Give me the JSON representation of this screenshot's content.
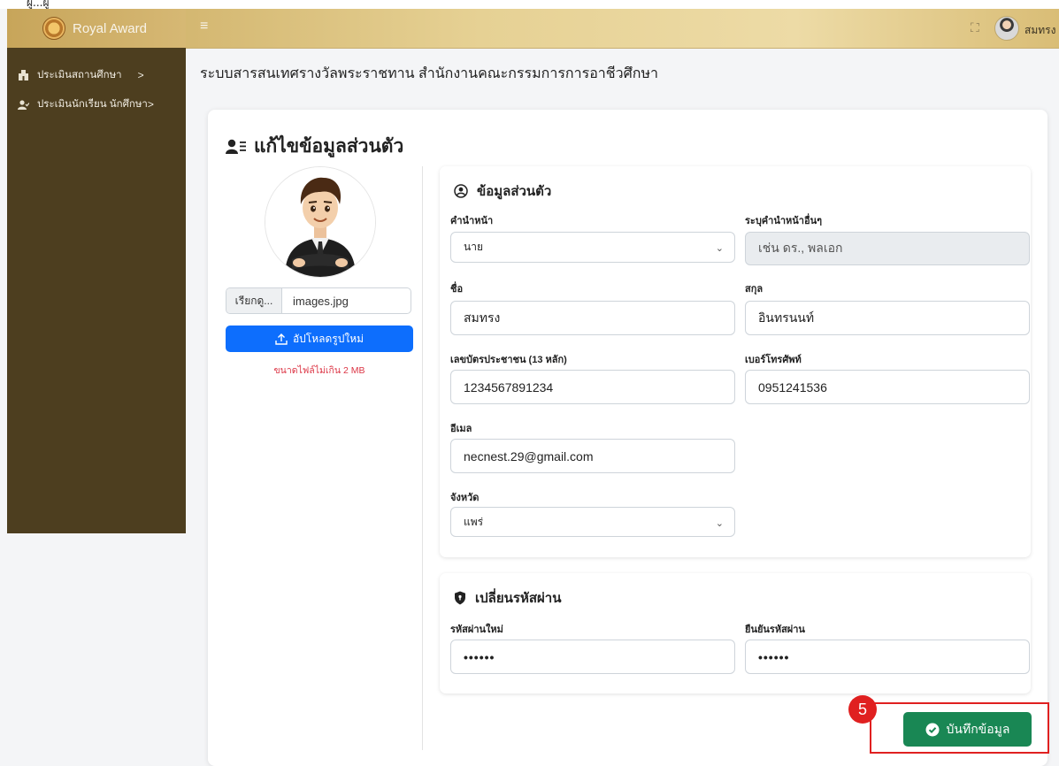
{
  "top_strip_text": "ผู้...ผู้",
  "header": {
    "brand": "Royal Award",
    "hamburger_icon": "menu-icon",
    "username": "สมทรง"
  },
  "sidebar": {
    "items": [
      {
        "label": "ประเมินสถานศึกษา",
        "icon": "building-icon",
        "chevron": ">"
      },
      {
        "label": "ประเมินนักเรียน นักศึกษา",
        "icon": "user-check-icon",
        "chevron": ">"
      }
    ]
  },
  "page": {
    "title": "ระบบสารสนเทศรางวัลพระราชทาน สำนักงานคณะกรรมการการอาชีวศึกษา"
  },
  "card": {
    "title": "แก้ไขข้อมูลส่วนตัว",
    "file": {
      "browse_label": "เรียกดู...",
      "file_name": "images.jpg",
      "upload_label": "อัปโหลดรูปใหม่",
      "note": "ขนาดไฟล์ไม่เกิน 2 MB"
    },
    "personal": {
      "title": "ข้อมูลส่วนตัว",
      "prefix_label": "คำนำหน้า",
      "prefix_value": "นาย",
      "other_prefix_label": "ระบุคำนำหน้าอื่นๆ",
      "other_prefix_placeholder": "เช่น ดร., พลเอก",
      "first_name_label": "ชื่อ",
      "first_name_value": "สมทรง",
      "last_name_label": "สกุล",
      "last_name_value": "อินทรนนท์",
      "id_label": "เลขบัตรประชาชน (13 หลัก)",
      "id_value": "1234567891234",
      "phone_label": "เบอร์โทรศัพท์",
      "phone_value": "0951241536",
      "email_label": "อีเมล",
      "email_value": "necnest.29@gmail.com",
      "province_label": "จังหวัด",
      "province_value": "แพร่"
    },
    "password": {
      "title": "เปลี่ยนรหัสผ่าน",
      "new_label": "รหัสผ่านใหม่",
      "new_value": "••••••",
      "confirm_label": "ยืนยันรหัสผ่าน",
      "confirm_value": "••••••"
    },
    "save_label": "บันทึกข้อมูล"
  },
  "annotation": {
    "number": "5",
    "color": "#e02020"
  },
  "colors": {
    "sidebar": "#4d3e1f",
    "primary": "#0d6efd",
    "success": "#198754",
    "danger": "#dc3545"
  }
}
